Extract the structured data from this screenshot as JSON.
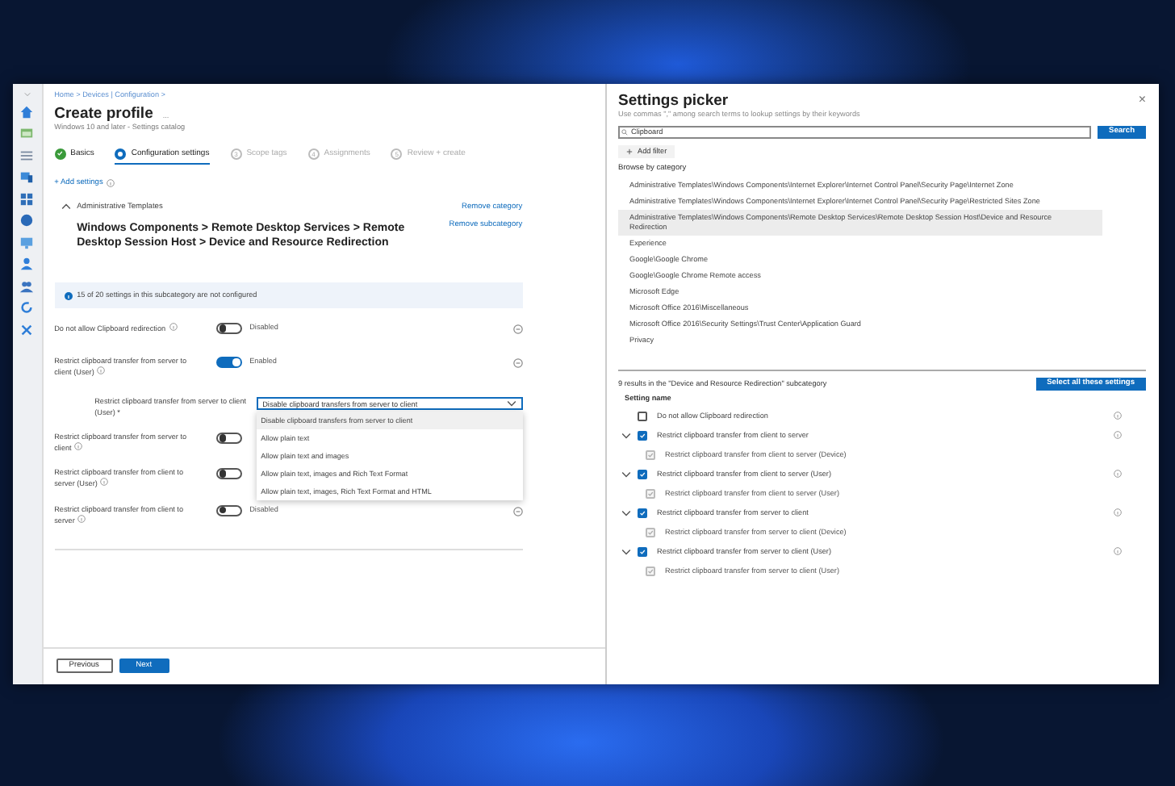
{
  "profile": {
    "breadcrumb": "Home > Devices | Configuration >",
    "title": "Create profile",
    "more": "...",
    "subtitle": "Windows 10 and later - Settings catalog",
    "steps": [
      {
        "label": "Basics",
        "completed": true,
        "selected": false
      },
      {
        "label": "Configuration settings",
        "completed": false,
        "selected": true
      },
      {
        "number": "3",
        "label": "Scope tags",
        "completed": false,
        "selected": false
      },
      {
        "number": "4",
        "label": "Assignments",
        "completed": false,
        "selected": false
      },
      {
        "number": "5",
        "label": "Review + create",
        "completed": false,
        "selected": false
      }
    ],
    "add_settings": "+ Add settings",
    "category": {
      "name": "Administrative Templates",
      "expanded": true,
      "remove": "Remove category"
    },
    "subcategory": {
      "name": "Windows Components > Remote Desktop Services > Remote Desktop Session Host > Device and Resource Redirection",
      "remove": "Remove subcategory"
    },
    "info": "15 of 20 settings in this subcategory are not configured",
    "settings": [
      {
        "kind": "toggle",
        "label": "Do not allow Clipboard redirection",
        "on": false,
        "state_text": "Disabled"
      },
      {
        "kind": "toggle",
        "label": "Restrict clipboard transfer from server to client (User)",
        "on": true,
        "state_text": "Enabled"
      },
      {
        "kind": "dropdown",
        "label": "Restrict clipboard transfer from server to client (User) *",
        "value": "Disable clipboard transfers from server to client",
        "expanded": true,
        "options": [
          {
            "label": "Disable clipboard transfers from server to client",
            "selected": true
          },
          {
            "label": "Allow plain text",
            "selected": false
          },
          {
            "label": "Allow plain text and images",
            "selected": false
          },
          {
            "label": "Allow plain text, images and Rich Text Format",
            "selected": false
          },
          {
            "label": "Allow plain text, images, Rich Text Format and HTML",
            "selected": false
          }
        ]
      },
      {
        "kind": "toggle",
        "label": "Restrict clipboard transfer from server to client",
        "on": false
      },
      {
        "kind": "toggle",
        "label": "Restrict clipboard transfer from client to server (User)",
        "on": false
      },
      {
        "kind": "toggle",
        "label": "Restrict clipboard transfer from client to server",
        "on": false,
        "state_text": "Disabled"
      }
    ],
    "buttons": [
      {
        "label": "Previous",
        "kind": "secondary"
      },
      {
        "label": "Next",
        "kind": "primary"
      }
    ]
  },
  "picker": {
    "title": "Settings picker",
    "close": "×",
    "hint": "Use commas \",\" among search terms to lookup settings by their keywords",
    "search": {
      "value": "Clipboard"
    },
    "search_button": "Search",
    "add_filter": "Add filter",
    "browse_label": "Browse by category",
    "categories": [
      {
        "label": "Administrative Templates\\Windows Components\\Internet Explorer\\Internet Control Panel\\Security Page\\Internet Zone",
        "selected": false
      },
      {
        "label": "Administrative Templates\\Windows Components\\Internet Explorer\\Internet Control Panel\\Security Page\\Restricted Sites Zone",
        "selected": false
      },
      {
        "label": "Administrative Templates\\Windows Components\\Remote Desktop Services\\Remote Desktop Session Host\\Device and Resource Redirection",
        "selected": true
      },
      {
        "label": "Experience",
        "selected": false
      },
      {
        "label": "Google\\Google Chrome",
        "selected": false
      },
      {
        "label": "Google\\Google Chrome Remote access",
        "selected": false
      },
      {
        "label": "Microsoft Edge",
        "selected": false
      },
      {
        "label": "Microsoft Office 2016\\Miscellaneous",
        "selected": false
      },
      {
        "label": "Microsoft Office 2016\\Security Settings\\Trust Center\\Application Guard",
        "selected": false
      },
      {
        "label": "Privacy",
        "selected": false
      }
    ],
    "results_label": "9 results in the \"Device and Resource Redirection\" subcategory",
    "select_all": "Select all these settings",
    "column": "Setting name",
    "results": [
      {
        "label": "Do not allow Clipboard redirection",
        "checked": false
      },
      {
        "label": "Restrict clipboard transfer from client to server",
        "checked": true,
        "expanded": true,
        "children": [
          {
            "label": "Restrict clipboard transfer from client to server (Device)",
            "checked": true
          }
        ]
      },
      {
        "label": "Restrict clipboard transfer from client to server (User)",
        "checked": true,
        "expanded": true,
        "children": [
          {
            "label": "Restrict clipboard transfer from client to server (User)",
            "checked": true
          }
        ]
      },
      {
        "label": "Restrict clipboard transfer from server to client",
        "checked": true,
        "expanded": true,
        "children": [
          {
            "label": "Restrict clipboard transfer from server to client (Device)",
            "checked": true
          }
        ]
      },
      {
        "label": "Restrict clipboard transfer from server to client (User)",
        "checked": true,
        "expanded": true,
        "children": [
          {
            "label": "Restrict clipboard transfer from server to client (User)",
            "checked": true
          }
        ]
      }
    ]
  }
}
